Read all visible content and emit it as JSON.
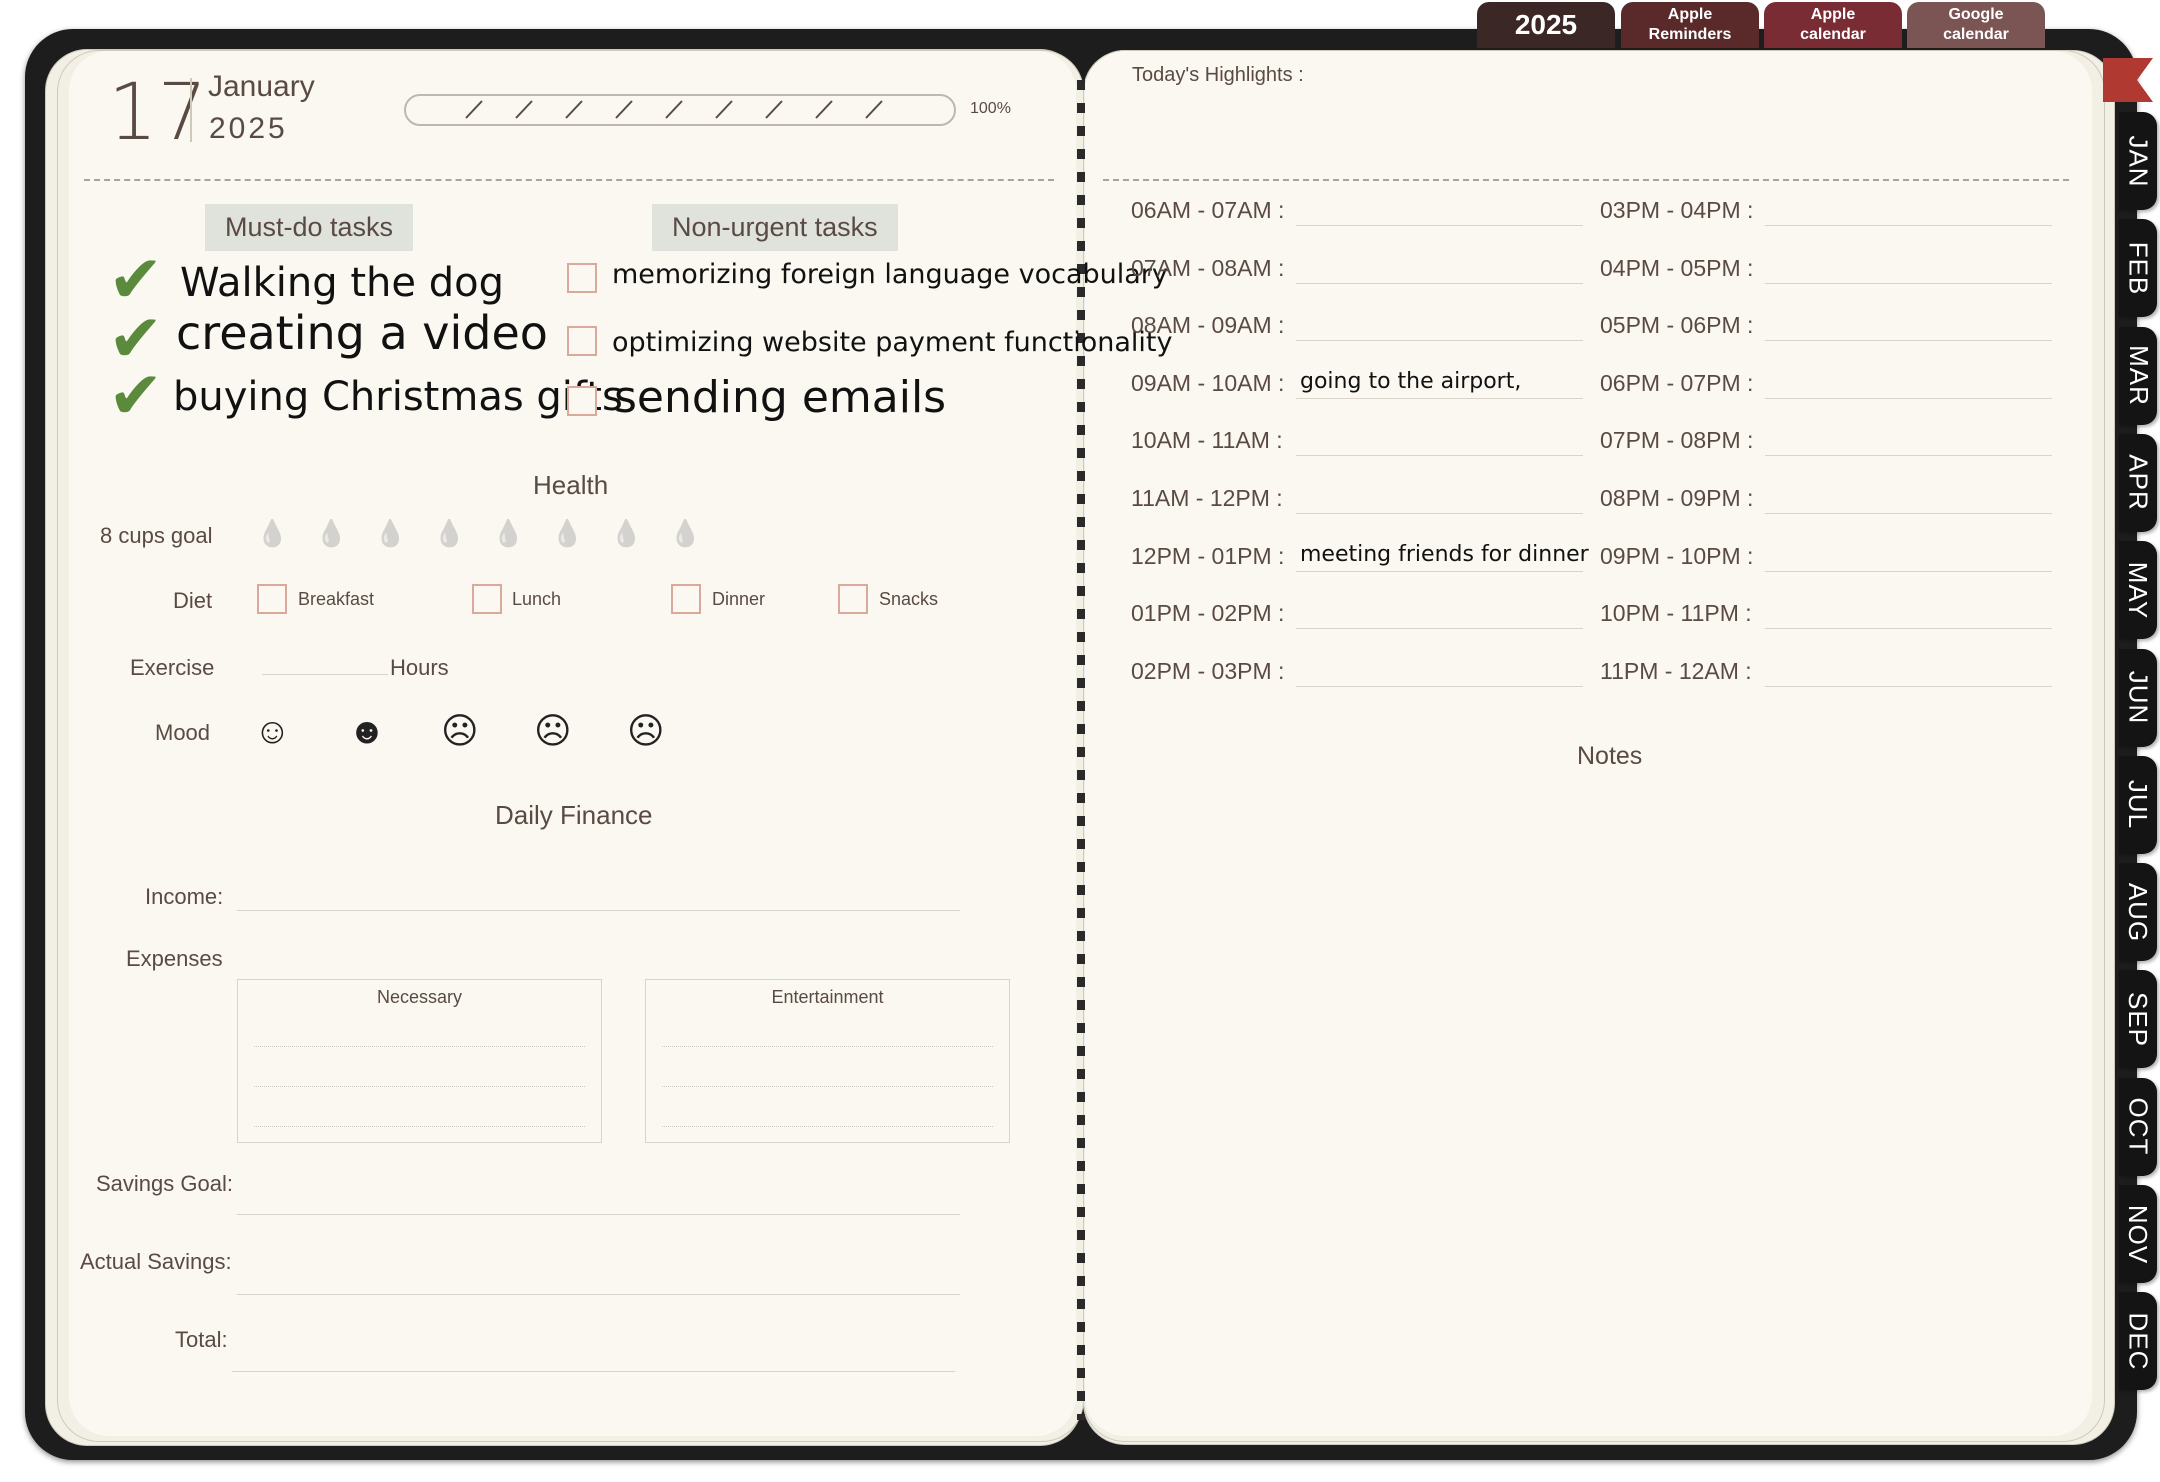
{
  "top_tabs": {
    "year": "2025",
    "apple_reminders": [
      "Apple",
      "Reminders"
    ],
    "apple_calendar": [
      "Apple",
      "calendar"
    ],
    "google_calendar": [
      "Google",
      "calendar"
    ],
    "colors": {
      "year": "#3b2725",
      "apple_reminders": "#5a2a2a",
      "apple_calendar": "#7a2c34",
      "google_calendar": "#7b5553"
    }
  },
  "months": [
    "JAN",
    "FEB",
    "MAR",
    "APR",
    "MAY",
    "JUN",
    "JUL",
    "AUG",
    "SEP",
    "OCT",
    "NOV",
    "DEC"
  ],
  "date": {
    "day": "17",
    "month": "January",
    "year": "2025"
  },
  "progress": {
    "value": 1.0,
    "label": "100%"
  },
  "tasks": {
    "must_do_title": "Must-do tasks",
    "non_urgent_title": "Non-urgent tasks",
    "must_do": [
      {
        "text": "Walking the dog",
        "done": true
      },
      {
        "text": "creating a video",
        "done": true
      },
      {
        "text": "buying Christmas gifts",
        "done": true
      }
    ],
    "non_urgent": [
      {
        "text": "memorizing foreign language vocabulary",
        "done": false
      },
      {
        "text": "optimizing website payment functionality",
        "done": false
      },
      {
        "text": "sending emails",
        "done": false
      }
    ]
  },
  "health": {
    "title": "Health",
    "water_label": "8 cups goal",
    "water_cups": 8,
    "diet_label": "Diet",
    "diet_items": [
      "Breakfast",
      "Lunch",
      "Dinner",
      "Snacks"
    ],
    "exercise_label": "Exercise",
    "exercise_unit": "Hours",
    "mood_label": "Mood",
    "moods": [
      "☺",
      "☻",
      "☹",
      "☹",
      "☹"
    ]
  },
  "finance": {
    "title": "Daily Finance",
    "income_label": "Income:",
    "expenses_label": "Expenses",
    "necessary_label": "Necessary",
    "entertainment_label": "Entertainment",
    "savings_goal_label": "Savings Goal:",
    "actual_savings_label": "Actual Savings:",
    "total_label": "Total:"
  },
  "highlights_label": "Today's Highlights :",
  "schedule_left": [
    {
      "time": "06AM - 07AM :",
      "entry": ""
    },
    {
      "time": "07AM - 08AM :",
      "entry": ""
    },
    {
      "time": "08AM - 09AM :",
      "entry": ""
    },
    {
      "time": "09AM - 10AM :",
      "entry": "going to the airport,"
    },
    {
      "time": "10AM - 11AM :",
      "entry": ""
    },
    {
      "time": "11AM - 12PM :",
      "entry": ""
    },
    {
      "time": "12PM - 01PM :",
      "entry": "meeting friends for dinner"
    },
    {
      "time": "01PM - 02PM :",
      "entry": ""
    },
    {
      "time": "02PM - 03PM :",
      "entry": ""
    }
  ],
  "schedule_right": [
    {
      "time": "03PM - 04PM :",
      "entry": ""
    },
    {
      "time": "04PM - 05PM :",
      "entry": ""
    },
    {
      "time": "05PM - 06PM :",
      "entry": ""
    },
    {
      "time": "06PM - 07PM :",
      "entry": ""
    },
    {
      "time": "07PM - 08PM :",
      "entry": ""
    },
    {
      "time": "08PM - 09PM :",
      "entry": ""
    },
    {
      "time": "09PM - 10PM :",
      "entry": ""
    },
    {
      "time": "10PM - 11PM :",
      "entry": ""
    },
    {
      "time": "11PM - 12AM :",
      "entry": ""
    }
  ],
  "notes_label": "Notes"
}
